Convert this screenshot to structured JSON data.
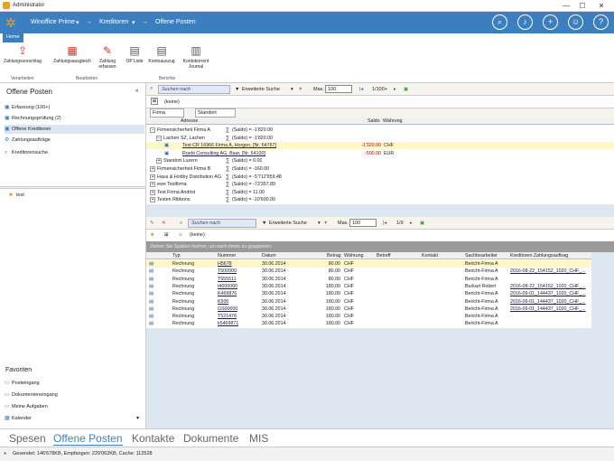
{
  "window": {
    "title": "Administrator",
    "minimize": "—",
    "maximize": "☐",
    "close": "✕"
  },
  "topnav": {
    "app": "Winoffice Prime",
    "sep1": "→",
    "module": "Kreditoren",
    "sep2": "→",
    "page": "Offene Posten"
  },
  "ribbon": {
    "tab": "Home",
    "buttons": [
      {
        "label": "Zahlungsvorschlag"
      },
      {
        "label": "Zahlungsausgleich"
      },
      {
        "label": "Zahlung erfassen"
      },
      {
        "label": "OP Liste"
      },
      {
        "label": "Kontoauszug"
      },
      {
        "label": "Kontokorrent Journal"
      }
    ],
    "groups": [
      "Verarbeiten",
      "Bearbeiten",
      "Berichte"
    ]
  },
  "left": {
    "title": "Offene Posten",
    "collapse": "«",
    "items": [
      {
        "label": "Erfassung (100+)"
      },
      {
        "label": "Rechnungsprüfung (2)"
      },
      {
        "label": "Offene Kreditoren"
      },
      {
        "label": "Zahlungsaufträge"
      },
      {
        "label": "Kreditorensuche"
      }
    ],
    "folder": "test",
    "favorites_title": "Favoriten",
    "favorites": [
      {
        "label": "Posteingang"
      },
      {
        "label": "Dokumenteneingang"
      },
      {
        "label": "Meine Aufgaben"
      },
      {
        "label": "Kalender"
      }
    ]
  },
  "top_grid": {
    "search_placeholder": "Suchen nach",
    "ext_search": "Erweiterte Suche",
    "max_label": "Max.",
    "max_value": "100",
    "pager": "1/100+",
    "filter": "(keine)",
    "group_chips": [
      "Firma",
      "Standort"
    ],
    "headers": {
      "adresse": "Adresse",
      "saldo": "Saldo",
      "waehrung": "Währung"
    },
    "rows": [
      {
        "level": 0,
        "sign": "−",
        "name": "Firmensicherheit Firma A",
        "sum": "(Saldo) = -1'820.00"
      },
      {
        "level": 1,
        "sign": "−",
        "name": "Lachen SZ, Lachen",
        "sum": "(Saldo) = -1'820.00"
      },
      {
        "level": 2,
        "name": "Test CR 16966 Firma A, Horgen, [Nr. 64767]",
        "saldo": "-1'320.00",
        "cur": "CHF",
        "hl": true
      },
      {
        "level": 2,
        "name": "Roebi Consulting AG, Baar, [Nr. 64100]",
        "saldo": "-500.00",
        "cur": "EUR"
      },
      {
        "level": 1,
        "sign": "+",
        "name": "Standort Luzern",
        "sum": "(Saldo) = 0.00"
      },
      {
        "level": 0,
        "sign": "+",
        "name": "Firmensicherheit Firma B",
        "sum": "(Saldo) = -160.00"
      },
      {
        "level": 0,
        "sign": "+",
        "name": "Haus & Hobby Distribution AG",
        "sum": "(Saldo) = -5'712'959.48"
      },
      {
        "level": 0,
        "sign": "+",
        "name": "ewo Testfirma",
        "sum": "(Saldo) = -73'357.89"
      },
      {
        "level": 0,
        "sign": "+",
        "name": "Test Firma Andrist",
        "sum": "(Saldo) = 11.00"
      },
      {
        "level": 0,
        "sign": "+",
        "name": "Testen Ribbons",
        "sum": "(Saldo) = -10'600.00"
      }
    ]
  },
  "bottom_grid": {
    "search_placeholder": "Suchen nach",
    "ext_search": "Erweiterte Suche",
    "max_label": "Max.",
    "max_value": "100",
    "pager": "1/9",
    "filter": "(keine)",
    "group_hint": "Ziehen Sie Spalten hierher, um nach ihnen zu gruppieren.",
    "headers": [
      "Typ",
      "Nummer",
      "Datum",
      "Betrag",
      "Währung",
      "Betreff",
      "Kontakt",
      "Sachbearbeiter",
      "Kreditoren Zahlungsauftrag"
    ],
    "rows": [
      {
        "typ": "Rechnung",
        "nr": "H5678",
        "datum": "30.06.2014",
        "betrag": "80.00",
        "cur": "CHF",
        "sb": "Bericht-Firma A",
        "za": ""
      },
      {
        "typ": "Rechnung",
        "nr": "T500000",
        "datum": "30.06.2014",
        "betrag": "80.00",
        "cur": "CHF",
        "sb": "Bericht-Firma A",
        "za": "2016-08-22_154152_1020_CHF_..."
      },
      {
        "typ": "Rechnung",
        "nr": "T555511",
        "datum": "30.06.2014",
        "betrag": "80.00",
        "cur": "CHF",
        "sb": "Bericht-Firma A",
        "za": ""
      },
      {
        "typ": "Rechnung",
        "nr": "t4000000",
        "datum": "30.06.2014",
        "betrag": "180.00",
        "cur": "CHF",
        "sb": "Burkart Robert",
        "za": "2016-08-22_154152_1020_CHF_..."
      },
      {
        "typ": "Rechnung",
        "nr": "K469876",
        "datum": "30.06.2014",
        "betrag": "180.00",
        "cur": "CHF",
        "sb": "Bericht-Firma A",
        "za": "2016-09-01_144437_1020_CHF_..."
      },
      {
        "typ": "Rechnung",
        "nr": "K500",
        "datum": "30.06.2014",
        "betrag": "180.00",
        "cur": "CHF",
        "sb": "Bericht-Firma A",
        "za": "2016-09-01_144437_1020_CHF_..."
      },
      {
        "typ": "Rechnung",
        "nr": "GS00000",
        "datum": "30.06.2014",
        "betrag": "180.00",
        "cur": "CHF",
        "sb": "Bericht-Firma A",
        "za": "2016-09-01_144437_1020_CHF_..."
      },
      {
        "typ": "Rechnung",
        "nr": "T521478",
        "datum": "30.06.2014",
        "betrag": "180.00",
        "cur": "CHF",
        "sb": "Bericht-Firma A",
        "za": ""
      },
      {
        "typ": "Rechnung",
        "nr": "k5469871",
        "datum": "30.06.2014",
        "betrag": "180.00",
        "cur": "CHF",
        "sb": "Bericht-Firma A",
        "za": ""
      }
    ]
  },
  "bottom_tabs": [
    "Spesen",
    "Offene Posten",
    "Kontakte",
    "Dokumente",
    "MIS"
  ],
  "status": "Gesendet: 146'678KB, Empfangen: 229'062KB, Cache: 112528"
}
